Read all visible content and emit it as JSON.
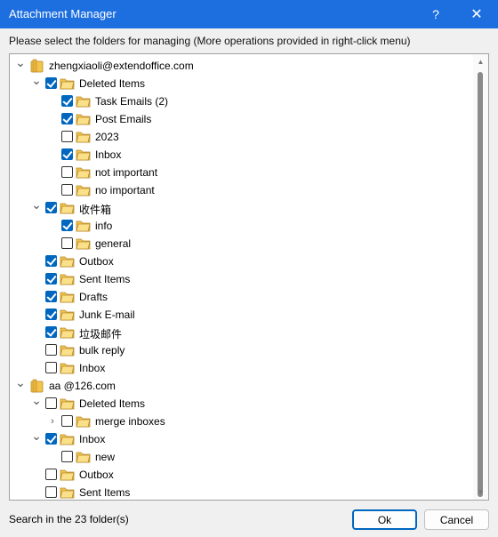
{
  "window": {
    "title": "Attachment Manager",
    "help_glyph": "?",
    "close_glyph": "✕"
  },
  "instruction": "Please select the folders for managing (More operations provided in right-click menu)",
  "tree": [
    {
      "level": 0,
      "type": "account",
      "expander": "expanded",
      "checkbox": false,
      "label": "zhengxiaoli@extendoffice.com"
    },
    {
      "level": 1,
      "type": "folder",
      "expander": "expanded",
      "checkbox": true,
      "checked": true,
      "label": "Deleted Items"
    },
    {
      "level": 2,
      "type": "folder",
      "expander": "none",
      "checkbox": true,
      "checked": true,
      "label": "Task Emails (2)"
    },
    {
      "level": 2,
      "type": "folder",
      "expander": "none",
      "checkbox": true,
      "checked": true,
      "label": "Post Emails"
    },
    {
      "level": 2,
      "type": "folder",
      "expander": "none",
      "checkbox": true,
      "checked": false,
      "label": "2023"
    },
    {
      "level": 2,
      "type": "folder",
      "expander": "none",
      "checkbox": true,
      "checked": true,
      "label": "Inbox"
    },
    {
      "level": 2,
      "type": "folder",
      "expander": "none",
      "checkbox": true,
      "checked": false,
      "label": "not important"
    },
    {
      "level": 2,
      "type": "folder",
      "expander": "none",
      "checkbox": true,
      "checked": false,
      "label": "no important"
    },
    {
      "level": 1,
      "type": "folder",
      "expander": "expanded",
      "checkbox": true,
      "checked": true,
      "label": "收件箱"
    },
    {
      "level": 2,
      "type": "folder",
      "expander": "none",
      "checkbox": true,
      "checked": true,
      "label": "info"
    },
    {
      "level": 2,
      "type": "folder",
      "expander": "none",
      "checkbox": true,
      "checked": false,
      "label": "general"
    },
    {
      "level": 1,
      "type": "folder",
      "expander": "none",
      "checkbox": true,
      "checked": true,
      "label": "Outbox"
    },
    {
      "level": 1,
      "type": "folder",
      "expander": "none",
      "checkbox": true,
      "checked": true,
      "label": "Sent Items"
    },
    {
      "level": 1,
      "type": "folder",
      "expander": "none",
      "checkbox": true,
      "checked": true,
      "label": "Drafts"
    },
    {
      "level": 1,
      "type": "folder",
      "expander": "none",
      "checkbox": true,
      "checked": true,
      "label": "Junk E-mail"
    },
    {
      "level": 1,
      "type": "folder",
      "expander": "none",
      "checkbox": true,
      "checked": true,
      "label": "垃圾邮件"
    },
    {
      "level": 1,
      "type": "folder",
      "expander": "none",
      "checkbox": true,
      "checked": false,
      "label": "bulk reply"
    },
    {
      "level": 1,
      "type": "folder",
      "expander": "none",
      "checkbox": true,
      "checked": false,
      "label": "Inbox"
    },
    {
      "level": 0,
      "type": "account",
      "expander": "expanded",
      "checkbox": false,
      "label": "aa     @126.com"
    },
    {
      "level": 1,
      "type": "folder",
      "expander": "expanded",
      "checkbox": true,
      "checked": false,
      "label": "Deleted Items"
    },
    {
      "level": 2,
      "type": "folder",
      "expander": "collapsed",
      "checkbox": true,
      "checked": false,
      "label": "merge inboxes"
    },
    {
      "level": 1,
      "type": "folder",
      "expander": "expanded",
      "checkbox": true,
      "checked": true,
      "label": "Inbox"
    },
    {
      "level": 2,
      "type": "folder",
      "expander": "none",
      "checkbox": true,
      "checked": false,
      "label": "new"
    },
    {
      "level": 1,
      "type": "folder",
      "expander": "none",
      "checkbox": true,
      "checked": false,
      "label": "Outbox"
    },
    {
      "level": 1,
      "type": "folder",
      "expander": "none",
      "checkbox": true,
      "checked": false,
      "label": "Sent Items"
    }
  ],
  "status": "Search in the 23 folder(s)",
  "buttons": {
    "ok": "Ok",
    "cancel": "Cancel"
  },
  "colors": {
    "titlebar": "#1d6fe0",
    "checkbox_checked": "#0067c0",
    "folder_yellow": "#f3c44a"
  }
}
